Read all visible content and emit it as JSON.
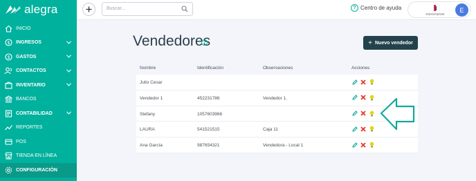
{
  "brand": {
    "name": "alegra"
  },
  "sidebar": {
    "items": [
      {
        "label": "INICIO",
        "icon": "home-icon",
        "bold": false,
        "chevron": false
      },
      {
        "label": "INGRESOS",
        "icon": "income-icon",
        "bold": true,
        "chevron": true
      },
      {
        "label": "GASTOS",
        "icon": "expenses-icon",
        "bold": true,
        "chevron": true
      },
      {
        "label": "CONTACTOS",
        "icon": "contacts-icon",
        "bold": true,
        "chevron": true
      },
      {
        "label": "INVENTARIO",
        "icon": "inventory-icon",
        "bold": true,
        "chevron": true
      },
      {
        "label": "BANCOS",
        "icon": "bank-icon",
        "bold": false,
        "chevron": false
      },
      {
        "label": "CONTABILIDAD",
        "icon": "accounting-icon",
        "bold": true,
        "chevron": true
      },
      {
        "label": "REPORTES",
        "icon": "reports-icon",
        "bold": false,
        "chevron": false
      },
      {
        "label": "POS",
        "icon": "pos-icon",
        "bold": false,
        "chevron": false
      },
      {
        "label": "TIENDA EN LÍNEA",
        "icon": "store-icon",
        "bold": false,
        "chevron": false
      },
      {
        "label": "CONFIGURACIÓN",
        "icon": "settings-icon",
        "bold": true,
        "chevron": false
      }
    ],
    "active_index": 10
  },
  "topbar": {
    "search_placeholder": "Buscar...",
    "help_label": "Centro de ayuda",
    "company_logo_text": "Empresa Ejemplar",
    "avatar_initial": "E"
  },
  "main": {
    "title": "Vendedores",
    "new_button_label": "Nuevo vendedor",
    "columns": [
      "Nombre",
      "Identificación",
      "Observaciones",
      "Acciones"
    ],
    "rows": [
      {
        "name": "Julio Cesar",
        "id": "",
        "obs": ""
      },
      {
        "name": "Vendedor 1",
        "id": "452231786",
        "obs": "Vendedor 1."
      },
      {
        "name": "Stefany",
        "id": "1057603966",
        "obs": ""
      },
      {
        "name": "LAURA",
        "id": "541521515",
        "obs": "Caja 11"
      },
      {
        "name": "Ana García",
        "id": "987654321",
        "obs": "Vendedora - Local 1"
      }
    ]
  },
  "colors": {
    "sidebar": "#00b19d",
    "primary_button": "#23424c",
    "edit": "#00b19d",
    "delete": "#e0392b",
    "status": "#d9c21a",
    "annotation_arrow": "#10a99a"
  }
}
